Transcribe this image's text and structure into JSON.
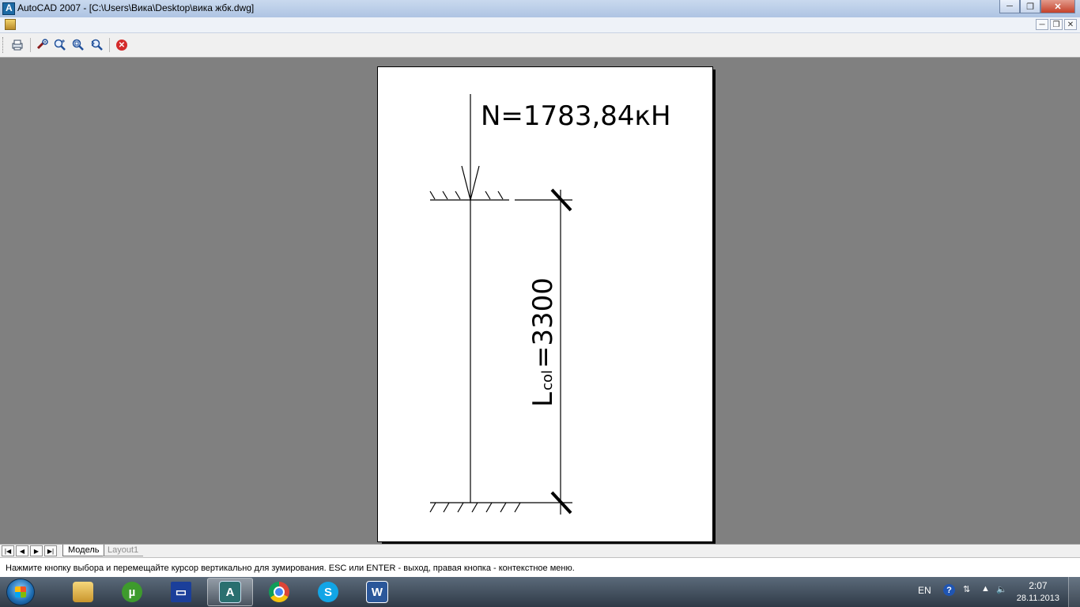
{
  "window": {
    "title": "AutoCAD 2007 - [C:\\Users\\Вика\\Desktop\\вика жбк.dwg]",
    "minimize_glyph": "─",
    "maximize_glyph": "❐",
    "close_glyph": "✕"
  },
  "mdi": {
    "minimize_glyph": "─",
    "restore_glyph": "❐",
    "close_glyph": "✕"
  },
  "toolbar": {
    "icons": [
      "plot-icon",
      "zoom-realtime-icon",
      "zoom-in-icon",
      "zoom-window-icon",
      "zoom-previous-icon",
      "close-preview-icon"
    ]
  },
  "drawing": {
    "force_label": "N=1783,84кН",
    "length_label_main": "L",
    "length_label_sub": "col",
    "length_label_value": "=3300"
  },
  "layout_tabs": {
    "nav": [
      "|◀",
      "◀",
      "▶",
      "▶|"
    ],
    "tabs": [
      {
        "label": "Модель",
        "active": true
      },
      {
        "label": "Layout1",
        "active": false
      }
    ]
  },
  "command": {
    "message": "Нажмите кнопку выбора и перемещайте курсор вертикально для зумирования. ESC или ENTER - выход, правая кнопка - контекстное меню."
  },
  "taskbar": {
    "apps": [
      {
        "name": "explorer",
        "active": false
      },
      {
        "name": "utorrent",
        "active": false
      },
      {
        "name": "save",
        "active": false
      },
      {
        "name": "autocad",
        "active": true
      },
      {
        "name": "chrome",
        "active": false
      },
      {
        "name": "skype",
        "active": false
      },
      {
        "name": "word",
        "active": false
      }
    ],
    "tray": {
      "language": "EN",
      "help": "?",
      "time": "2:07",
      "date": "28.11.2013"
    }
  },
  "colors": {
    "canvas_bg": "#808080",
    "paper": "#ffffff",
    "ink": "#000000"
  }
}
